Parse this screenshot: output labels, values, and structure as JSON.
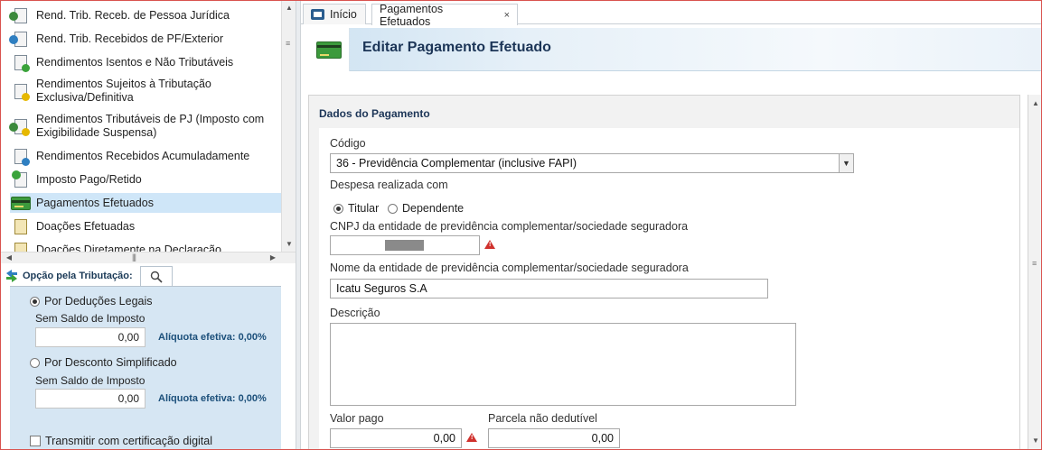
{
  "nav": {
    "items": [
      {
        "label": "Rend. Trib. Receb. de Pessoa Jurídica",
        "icon": "income-pj-icon"
      },
      {
        "label": "Rend. Trib. Recebidos de PF/Exterior",
        "icon": "income-pf-exterior-icon"
      },
      {
        "label": "Rendimentos Isentos e Não Tributáveis",
        "icon": "exempt-income-icon"
      },
      {
        "label_line1": "Rendimentos Sujeitos à Tributação",
        "label_line2": "Exclusiva/Definitiva",
        "icon": "exclusive-tax-icon"
      },
      {
        "label_line1": "Rendimentos Tributáveis de PJ (Imposto com",
        "label_line2": "Exigibilidade Suspensa)",
        "icon": "suspended-tax-icon"
      },
      {
        "label": "Rendimentos Recebidos Acumuladamente",
        "icon": "accumulated-income-icon"
      },
      {
        "label": "Imposto Pago/Retido",
        "icon": "tax-paid-icon"
      },
      {
        "label": "Pagamentos Efetuados",
        "icon": "payment-card-icon",
        "selected": true
      },
      {
        "label": "Doações Efetuadas",
        "icon": "donation-icon"
      },
      {
        "label": "Doações Diretamente na Declaração",
        "icon": "direct-donation-icon"
      }
    ]
  },
  "opcao": {
    "title": "Opção pela Tributação:",
    "deducoes": {
      "label": "Por Deduções Legais",
      "sublabel": "Sem Saldo de Imposto",
      "value": "0,00",
      "aliquota": "Alíquota efetiva: 0,00%",
      "selected": true
    },
    "simplificado": {
      "label": "Por Desconto Simplificado",
      "sublabel": "Sem Saldo de Imposto",
      "value": "0,00",
      "aliquota": "Alíquota efetiva: 0,00%",
      "selected": false
    },
    "transmitir": {
      "label": "Transmitir com certificação digital",
      "checked": false
    }
  },
  "tabs": [
    {
      "label": "Início",
      "icon": "home-icon"
    },
    {
      "label": "Pagamentos Efetuados",
      "close": "×",
      "active": true
    }
  ],
  "banner": {
    "title": "Editar Pagamento Efetuado"
  },
  "form": {
    "section_title": "Dados do Pagamento",
    "codigo_label": "Código",
    "codigo_value": "36 - Previdência Complementar (inclusive FAPI)",
    "despesa_label": "Despesa realizada com",
    "titular_label": "Titular",
    "dependente_label": "Dependente",
    "cnpj_label": "CNPJ da entidade de previdência complementar/sociedade seguradora",
    "cnpj_value": "",
    "nome_label": "Nome da entidade de previdência complementar/sociedade seguradora",
    "nome_value": "Icatu Seguros S.A",
    "descricao_label": "Descrição",
    "descricao_value": "",
    "valor_pago_label": "Valor pago",
    "valor_pago_value": "0,00",
    "parcela_label": "Parcela não dedutível",
    "parcela_value": "0,00"
  },
  "colors": {
    "selected_bg": "#cfe6f8",
    "opcao_panel_bg": "#d6e6f3",
    "title_blue": "#1c3557",
    "warning_red": "#d0312d",
    "frame_border": "#d9534f"
  }
}
